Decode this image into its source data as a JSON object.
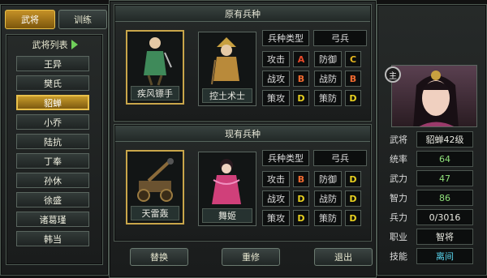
{
  "tabs": [
    "武将",
    "训练"
  ],
  "list_title": "武将列表",
  "generals": [
    "王异",
    "樊氏",
    "貂蝉",
    "小乔",
    "陆抗",
    "丁奉",
    "孙休",
    "徐盛",
    "诸葛瑾",
    "韩当"
  ],
  "selected_index": 2,
  "original": {
    "title": "原有兵种",
    "units": [
      {
        "name": "疾风镖手"
      },
      {
        "name": "控土术士"
      }
    ],
    "type_label": "兵种类型",
    "type_value": "弓兵",
    "stats": [
      {
        "label": "攻击",
        "grade": "A"
      },
      {
        "label": "防御",
        "grade": "C"
      },
      {
        "label": "战攻",
        "grade": "B"
      },
      {
        "label": "战防",
        "grade": "B"
      },
      {
        "label": "策攻",
        "grade": "D"
      },
      {
        "label": "策防",
        "grade": "D"
      }
    ]
  },
  "current": {
    "title": "现有兵种",
    "units": [
      {
        "name": "天雷轰"
      },
      {
        "name": "舞姬"
      }
    ],
    "type_label": "兵种类型",
    "type_value": "弓兵",
    "stats": [
      {
        "label": "攻击",
        "grade": "B"
      },
      {
        "label": "防御",
        "grade": "D"
      },
      {
        "label": "战攻",
        "grade": "D"
      },
      {
        "label": "战防",
        "grade": "D"
      },
      {
        "label": "策攻",
        "grade": "D"
      },
      {
        "label": "策防",
        "grade": "D"
      }
    ]
  },
  "buttons": {
    "replace": "替换",
    "repair": "重修",
    "exit": "退出"
  },
  "profile": {
    "badge": "主",
    "stats": [
      {
        "label": "武将",
        "value": "貂蝉42级"
      },
      {
        "label": "统率",
        "value": "64"
      },
      {
        "label": "武力",
        "value": "47"
      },
      {
        "label": "智力",
        "value": "86"
      },
      {
        "label": "兵力",
        "value": "0/3016"
      },
      {
        "label": "职业",
        "value": "智将"
      },
      {
        "label": "技能",
        "value": "离间"
      }
    ]
  },
  "grade_colors": {
    "A": "#e84a2a",
    "B": "#f06a30",
    "C": "#e8b820",
    "D": "#e8d020"
  },
  "value_colors": {
    "default": "#e8e8e0",
    "accent": "#8fe07a",
    "skill": "#5ad7f0"
  },
  "icons": [
    "collapse-arrow-icon",
    "unit-portrait",
    "general-portrait"
  ]
}
